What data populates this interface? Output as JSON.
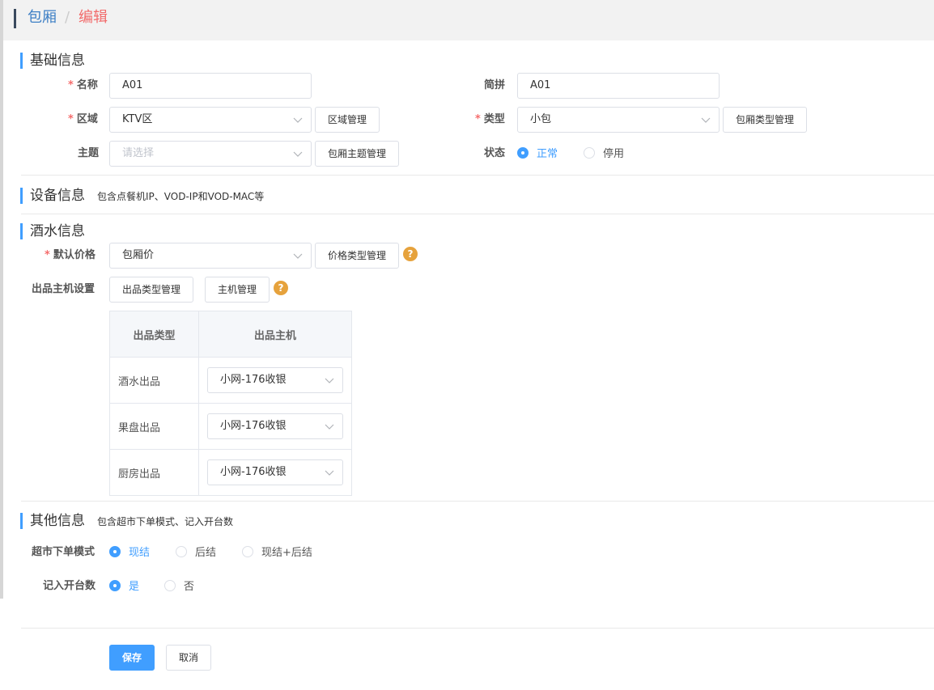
{
  "breadcrumb": {
    "parent": "包厢",
    "separator": "/",
    "current": "编辑"
  },
  "sections": {
    "basic": {
      "title": "基础信息"
    },
    "device": {
      "title": "设备信息",
      "subtitle": "包含点餐机IP、VOD-IP和VOD-MAC等"
    },
    "drinks": {
      "title": "酒水信息"
    },
    "other": {
      "title": "其他信息",
      "subtitle": "包含超市下单模式、记入开台数"
    }
  },
  "basic": {
    "name": {
      "label": "名称",
      "value": "A01"
    },
    "pinyin": {
      "label": "简拼",
      "value": "A01"
    },
    "area": {
      "label": "区域",
      "value": "KTV区",
      "manage_label": "区域管理"
    },
    "type": {
      "label": "类型",
      "value": "小包",
      "manage_label": "包厢类型管理"
    },
    "theme": {
      "label": "主题",
      "placeholder": "请选择",
      "manage_label": "包厢主题管理"
    },
    "status": {
      "label": "状态",
      "options": [
        "正常",
        "停用"
      ],
      "selected": "正常"
    }
  },
  "drinks": {
    "default_price": {
      "label": "默认价格",
      "value": "包厢价",
      "manage_label": "价格类型管理"
    },
    "host_setting": {
      "label": "出品主机设置",
      "type_manage_label": "出品类型管理",
      "host_manage_label": "主机管理"
    },
    "table": {
      "headers": [
        "出品类型",
        "出品主机"
      ],
      "rows": [
        {
          "type": "酒水出品",
          "host": "小网-176收银"
        },
        {
          "type": "果盘出品",
          "host": "小网-176收银"
        },
        {
          "type": "厨房出品",
          "host": "小网-176收银"
        }
      ]
    }
  },
  "other": {
    "mode": {
      "label": "超市下单模式",
      "options": [
        "现结",
        "后结",
        "现结+后结"
      ],
      "selected": "现结"
    },
    "count": {
      "label": "记入开台数",
      "options": [
        "是",
        "否"
      ],
      "selected": "是"
    }
  },
  "actions": {
    "save": "保存",
    "cancel": "取消"
  },
  "help_glyph": "?",
  "colors": {
    "primary": "#409eff",
    "required": "#f56c6c",
    "help": "#e6a23c",
    "breadcrumb_current": "#f26b6b",
    "breadcrumb_parent": "#3d7fc5"
  }
}
